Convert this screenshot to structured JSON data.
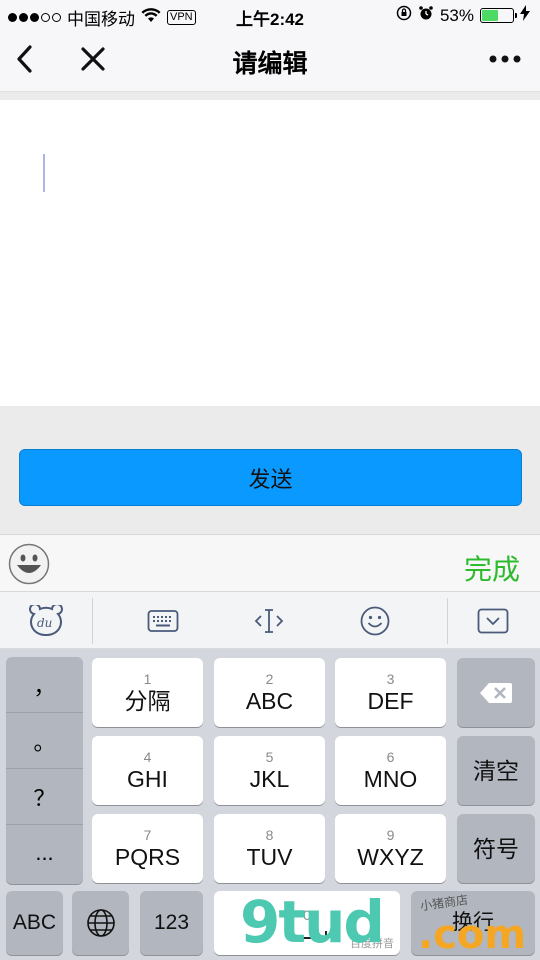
{
  "status_bar": {
    "carrier": "中国移动",
    "vpn": "VPN",
    "time": "上午2:42",
    "battery_percent": "53%",
    "battery_level": 0.53,
    "battery_color": "#4cd964"
  },
  "nav": {
    "title": "请编辑",
    "back_icon": "chevron-left-icon",
    "close_icon": "close-icon",
    "more_icon": "more-icon"
  },
  "editor": {
    "value": ""
  },
  "send_button": {
    "label": "发送",
    "color": "#0a9aff"
  },
  "emoji_bar": {
    "done_label": "完成",
    "done_color": "#2dbb2d"
  },
  "ime_toolbar": {
    "items": [
      "du-logo-icon",
      "keyboard-icon",
      "cursor-move-icon",
      "emoji-icon",
      "collapse-keyboard-icon"
    ]
  },
  "keyboard": {
    "punctuation": [
      "，",
      "。",
      "？",
      "..."
    ],
    "keys": [
      {
        "num": "1",
        "label": "分隔"
      },
      {
        "num": "2",
        "label": "ABC"
      },
      {
        "num": "3",
        "label": "DEF"
      },
      {
        "num": "4",
        "label": "GHI"
      },
      {
        "num": "5",
        "label": "JKL"
      },
      {
        "num": "6",
        "label": "MNO"
      },
      {
        "num": "7",
        "label": "PQRS"
      },
      {
        "num": "8",
        "label": "TUV"
      },
      {
        "num": "9",
        "label": "WXYZ"
      }
    ],
    "clear_label": "清空",
    "symbols_label": "符号",
    "abc_label": "ABC",
    "num_label": "123",
    "space_num": "0",
    "space_hint": "百度拼音",
    "return_label": "换行"
  },
  "watermark": {
    "brand": "9tud",
    "tld": ".com",
    "tagline": "小猪商店"
  }
}
